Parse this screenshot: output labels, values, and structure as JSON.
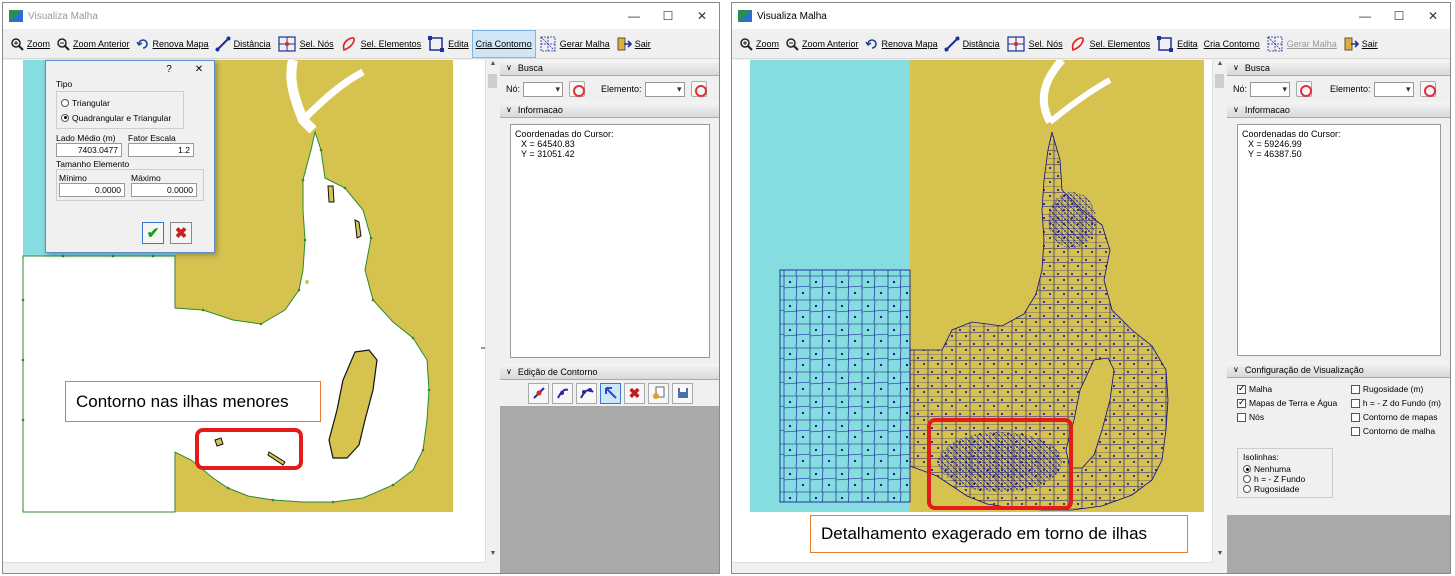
{
  "left_window": {
    "title": "Visualiza Malha",
    "toolbar": [
      "Zoom",
      "Zoom Anterior",
      "Renova Mapa",
      "Distância",
      "Sel. Nós",
      "Sel. Elementos",
      "Edita",
      "Cria Contorno",
      "Gerar Malha",
      "Sair"
    ],
    "active_tool": "Cria Contorno",
    "busca": {
      "header": "Busca",
      "no_label": "Nó:",
      "elemento_label": "Elemento:"
    },
    "informacao": {
      "header": "Informacao",
      "coords_label": "Coordenadas do Cursor:",
      "x": "X = 64540.83",
      "y": "Y = 31051.42"
    },
    "edicao": {
      "header": "Edição de Contorno"
    },
    "callout": "Contorno nas ilhas menores"
  },
  "dialog": {
    "help": "?",
    "close": "✕",
    "tipo_label": "Tipo",
    "options": [
      "Triangular",
      "Quadrangular e Triangular"
    ],
    "selected_option": "Quadrangular e Triangular",
    "lado_medio_label": "Lado Médio (m)",
    "lado_medio_value": "7403.0477",
    "fator_escala_label": "Fator Escala",
    "fator_escala_value": "1.2",
    "tamanho_label": "Tamanho Elemento",
    "minimo_label": "Mínimo",
    "minimo_value": "0.0000",
    "maximo_label": "Máximo",
    "maximo_value": "0.0000"
  },
  "right_window": {
    "title": "Visualiza Malha",
    "toolbar": [
      "Zoom",
      "Zoom Anterior",
      "Renova Mapa",
      "Distância",
      "Sel. Nós",
      "Sel. Elementos",
      "Edita",
      "Cria Contorno",
      "Gerar Malha",
      "Sair"
    ],
    "disabled_tool": "Gerar Malha",
    "busca": {
      "header": "Busca",
      "no_label": "Nó:",
      "elemento_label": "Elemento:"
    },
    "informacao": {
      "header": "Informacao",
      "coords_label": "Coordenadas do Cursor:",
      "x": "X = 59246.99",
      "y": "Y = 46387.50"
    },
    "config": {
      "header": "Configuração de Visualização",
      "left_checks": [
        {
          "label": "Malha",
          "checked": true
        },
        {
          "label": "Mapas de Terra e Água",
          "checked": true
        },
        {
          "label": "Nós",
          "checked": false
        }
      ],
      "right_checks": [
        {
          "label": "Rugosidade (m)",
          "checked": false
        },
        {
          "label": "h = - Z do Fundo (m)",
          "checked": false
        },
        {
          "label": "Contorno de mapas",
          "checked": false
        },
        {
          "label": "Contorno de malha",
          "checked": false
        }
      ],
      "isolinhas_label": "Isolinhas:",
      "isolinhas": [
        {
          "label": "Nenhuma",
          "selected": true
        },
        {
          "label": "h = - Z Fundo",
          "selected": false
        },
        {
          "label": "Rugosidade",
          "selected": false
        }
      ]
    },
    "callout": "Detalhamento  exagerado em torno de ilhas"
  },
  "colors": {
    "land": "#d6c24f",
    "water": "#86dde0",
    "mesh": "#0a0a8c",
    "contour": "#2d8a2d",
    "accent": "#e31b1b",
    "callout_border": "#e87b2c"
  }
}
